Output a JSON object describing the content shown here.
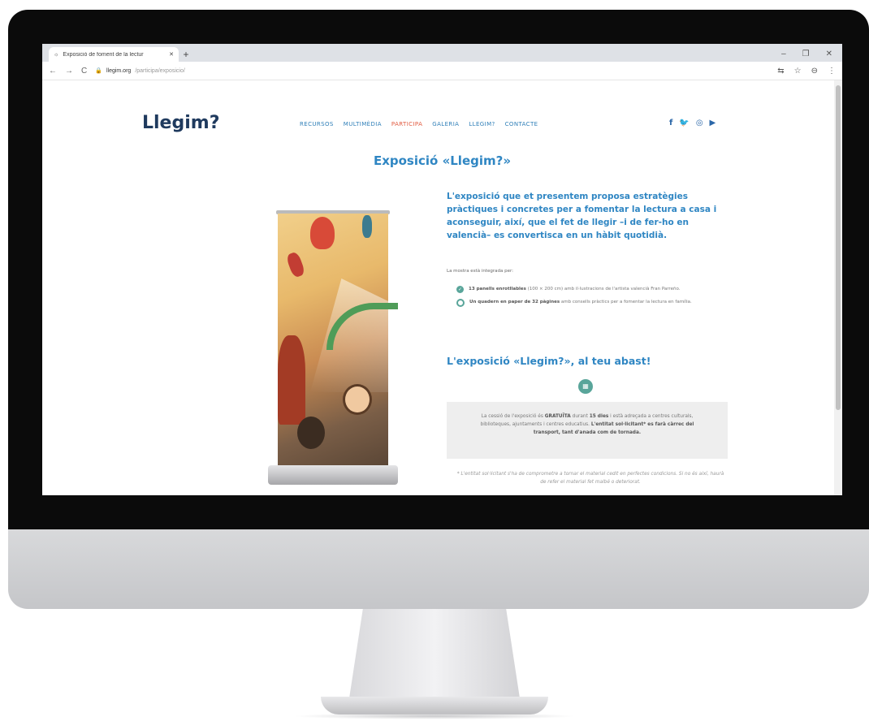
{
  "browser": {
    "tab_title": "Exposició de foment de la lectur",
    "tab_close": "✕",
    "new_tab": "+",
    "window_controls": [
      "–",
      "❐",
      "✕"
    ],
    "nav_icons": [
      "←",
      "→",
      "C"
    ],
    "url_domain": "llegim.org",
    "url_path": "/participa/exposicio/",
    "toolbar_right": [
      "⇆",
      "☆",
      "⊖",
      "⋮"
    ]
  },
  "site": {
    "logo": "Llegim?",
    "nav": [
      "RECURSOS",
      "MULTIMÈDIA",
      "PARTICIPA",
      "GALERIA",
      "LLEGIM?",
      "CONTACTE"
    ],
    "social_icons": [
      "f",
      "🐦",
      "◎",
      "▶"
    ],
    "page_title": "Exposició «Llegim?»",
    "intro": "L'exposició que et presentem proposa estratègies pràctiques i concretes per a fomentar la lectura a casa i aconseguir, així, que el fet de llegir –i de fer-ho en valencià– es convertisca en un hàbit quotidià.",
    "mostra_label": "La mostra està integrada per:",
    "items": [
      {
        "bold": "13 panells enrotllables",
        "text": " (100 × 200 cm) amb il·lustracions de l'artista valencià Fran Parreño."
      },
      {
        "bold": "Un quadern en paper de 32 pàgines",
        "text": " amb consells pràctics per a fomentar la lectura en família."
      }
    ],
    "section_title": "L'exposició «Llegim?», al teu abast!",
    "box_parts": {
      "p1": "La cessió de l'exposició és ",
      "b1": "GRATUÏTA",
      "p2": " durant ",
      "b2": "15 dies",
      "p3": " i està adreçada a centres culturals, biblioteques, ajuntaments i centres educatius. ",
      "b3": "L'entitat sol·licitant* es farà càrrec del transport, tant d'anada com de tornada."
    },
    "footnote": "* L'entitat sol·licitant s'ha de comprometre a tornar el material cedit en perfectes condicions. Si no és així, haurà de refer el material fet malbé o deteriorat."
  }
}
